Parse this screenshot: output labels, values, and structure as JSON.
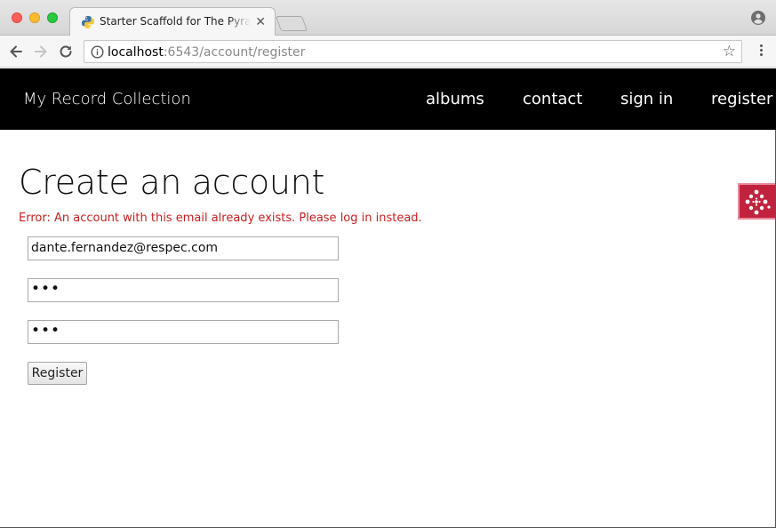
{
  "browser": {
    "tab_title": "Starter Scaffold for The Pyramid Web Framework",
    "tab_close": "✕",
    "url_host": "localhost",
    "url_rest": ":6543/account/register",
    "icons": {
      "favicon": "python-logo-icon",
      "profile": "user-profile-icon",
      "back": "back-arrow-icon",
      "forward": "forward-arrow-icon",
      "reload": "reload-icon",
      "info": "info-icon",
      "star": "bookmark-star-icon",
      "menu": "kebab-menu-icon"
    },
    "star_glyph": "☆"
  },
  "site": {
    "brand": "My Record Collection",
    "nav": {
      "albums": "albums",
      "contact": "contact",
      "signin": "sign in",
      "register": "register"
    },
    "colors": {
      "nav_bg": "#000000",
      "error": "#c81e1e",
      "debug_toolbar": "#c1233f"
    }
  },
  "form": {
    "title": "Create an account",
    "error": "Error: An account with this email already exists. Please log in instead.",
    "email_value": "dante.fernandez@respec.com",
    "password_value": "•••",
    "confirm_value": "•••",
    "submit_label": "Register"
  }
}
